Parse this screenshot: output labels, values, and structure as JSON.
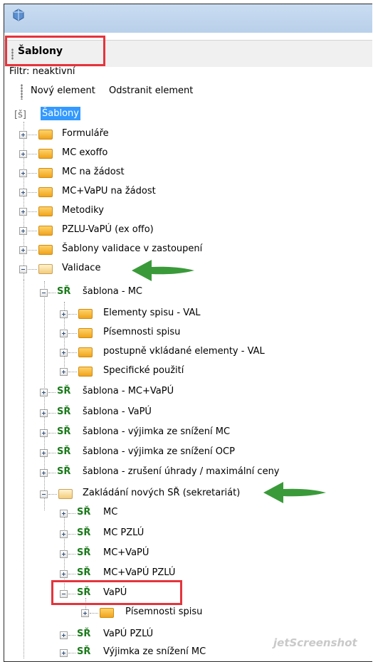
{
  "panel": {
    "title": "Šablony",
    "filter_label": "Filtr: neaktivní"
  },
  "toolbar": {
    "new_element": "Nový element",
    "remove_element": "Odstranit element"
  },
  "tree": {
    "root": {
      "icon_text": "[š]",
      "label": "Šablony"
    },
    "items": [
      "Formuláře",
      "MC exoffo",
      "MC na žádost",
      "MC+VaPU na žádost",
      "Metodiky",
      "PZLU-VaPÚ (ex offo)",
      "Šablony validace v zastoupení",
      "Validace",
      "šablona - MC",
      "Elementy spisu - VAL",
      "Písemnosti spisu",
      "postupně vkládané elementy - VAL",
      "Specifické použití",
      "šablona - MC+VaPÚ",
      "šablona - VaPÚ",
      "šablona - výjimka ze snížení MC",
      "šablona - výjimka ze snížení OCP",
      "šablona - zrušení úhrady / maximální ceny",
      "Zakládání nových SŘ (sekretariát)",
      "MC",
      "MC PZLÚ",
      "MC+VaPÚ",
      "MC+VaPÚ PZLÚ",
      "VaPÚ",
      "Písemnosti spisu",
      "VaPÚ PZLÚ",
      "Výjimka ze snížení MC"
    ],
    "sr_badge": "SŘ"
  },
  "watermark": "jetScreenshot",
  "colors": {
    "highlight": "#e5343c",
    "arrow": "#3a9a3a",
    "sr_green": "#1a7a1a",
    "selection": "#3399ff"
  }
}
